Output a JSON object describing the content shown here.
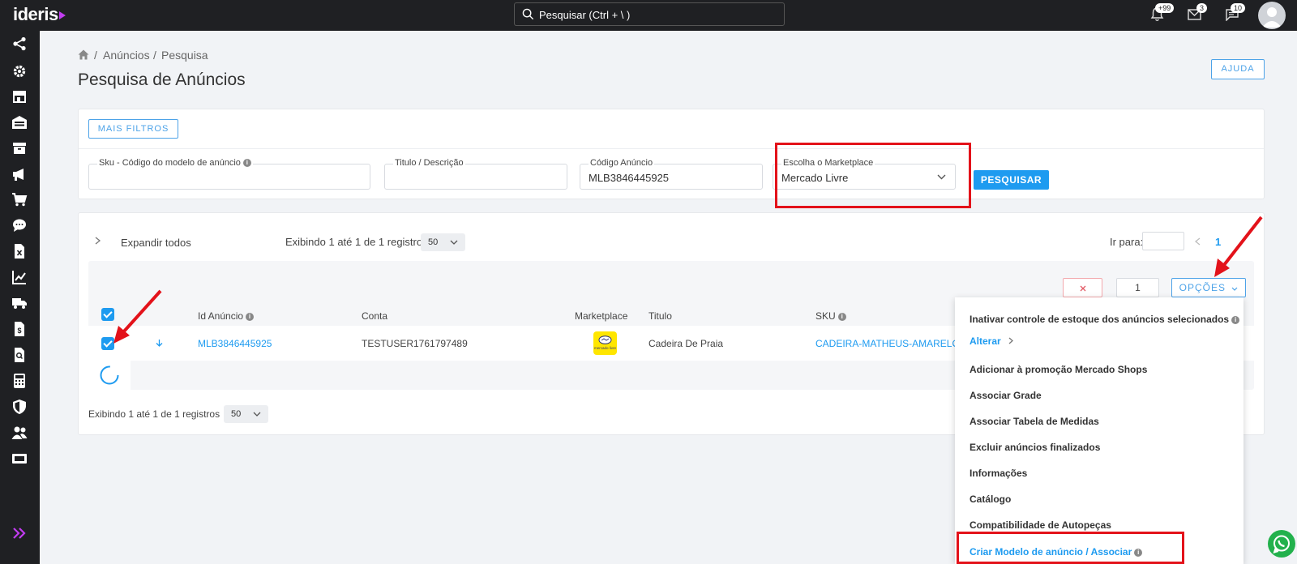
{
  "topbar": {
    "logo": "ideris",
    "search_placeholder": "Pesquisar (Ctrl + \\ )",
    "notifications_count": "+99",
    "mail_count": "3",
    "chat_count": "10"
  },
  "breadcrumb": {
    "home_icon": "home-icon",
    "sep1": "/",
    "item1": "Anúncios",
    "sep2": "/",
    "item2": "Pesquisa"
  },
  "page": {
    "title": "Pesquisa de Anúncios",
    "help_label": "AJUDA"
  },
  "filters": {
    "more_filters_label": "MAIS FILTROS",
    "sku_label": "Sku - Código do modelo de anúncio",
    "sku_value": "",
    "title_label": "Titulo / Descrição",
    "title_value": "",
    "code_label": "Código Anúncio",
    "code_value": "MLB3846445925",
    "marketplace_label": "Escolha o Marketplace",
    "marketplace_value": "Mercado Livre",
    "search_button": "PESQUISAR"
  },
  "results": {
    "expand_all": "Expandir todos",
    "showing_top": "Exibindo 1 até 1 de 1 registros",
    "page_size": "50",
    "goto_label": "Ir para:",
    "current_page": "1",
    "selected_count": "1",
    "options_label": "OPÇÕES",
    "showing_bottom": "Exibindo 1 até 1 de 1 registros",
    "page_size_bottom": "50"
  },
  "table": {
    "headers": {
      "id": "Id Anúncio",
      "account": "Conta",
      "marketplace": "Marketplace",
      "title": "Titulo",
      "sku": "SKU"
    },
    "rows": [
      {
        "id": "MLB3846445925",
        "account": "TESTUSER1761797489",
        "marketplace_logo": "mercado livre",
        "title": "Cadeira De Praia",
        "sku": "CADEIRA-MATHEUS-AMARELO"
      }
    ]
  },
  "options_menu": {
    "items": [
      "Inativar controle de estoque dos anúncios selecionados",
      "Alterar",
      "Adicionar à promoção Mercado Shops",
      "Associar Grade",
      "Associar Tabela de Medidas",
      "Excluir anúncios finalizados",
      "Informações",
      "Catálogo",
      "Compatibilidade de Autopeças",
      "Criar Modelo de anúncio / Associar"
    ]
  },
  "colors": {
    "accent": "#1e9bf0",
    "highlight": "#e3121a",
    "topbar": "#1f2023"
  }
}
